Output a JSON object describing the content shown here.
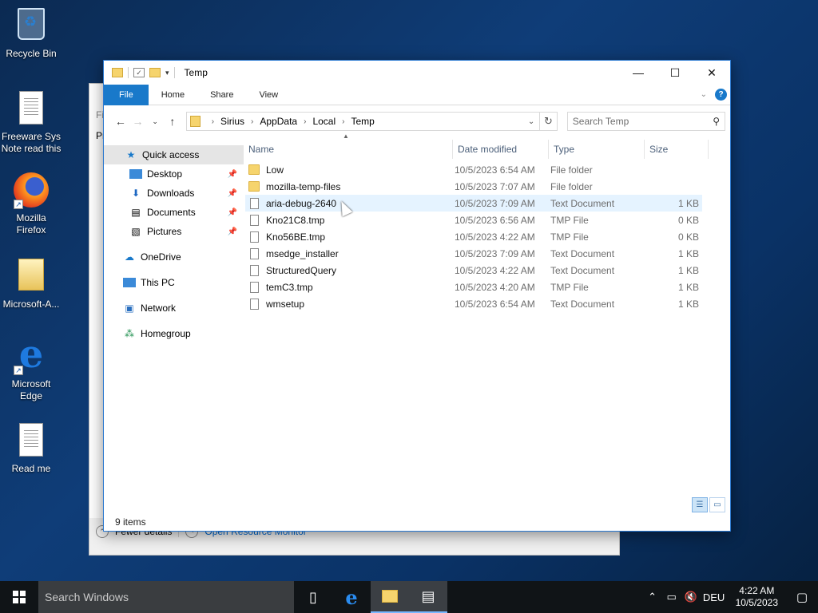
{
  "desktop": {
    "icons": [
      {
        "label": "Recycle Bin",
        "icon": "recycle-bin-icon"
      },
      {
        "label": "Freeware Sys Note read this",
        "icon": "text-document-icon"
      },
      {
        "label": "Mozilla Firefox",
        "icon": "firefox-icon"
      },
      {
        "label": "Microsoft-A...",
        "icon": "folder-icon"
      },
      {
        "label": "Microsoft Edge",
        "icon": "edge-icon"
      },
      {
        "label": "Read me",
        "icon": "text-document-icon"
      }
    ]
  },
  "background_window": {
    "menu_fragment": "Fi",
    "tab_fragment": "Pr",
    "fewer_details": "Fewer details",
    "open_resource_monitor": "Open Resource Monitor"
  },
  "explorer": {
    "title": "Temp",
    "ribbon_tabs": [
      "File",
      "Home",
      "Share",
      "View"
    ],
    "breadcrumb": [
      "Sirius",
      "AppData",
      "Local",
      "Temp"
    ],
    "search_placeholder": "Search Temp",
    "nav": {
      "quick_access": "Quick access",
      "pinned": [
        "Desktop",
        "Downloads",
        "Documents",
        "Pictures"
      ],
      "onedrive": "OneDrive",
      "this_pc": "This PC",
      "network": "Network",
      "homegroup": "Homegroup"
    },
    "columns": {
      "name": "Name",
      "date": "Date modified",
      "type": "Type",
      "size": "Size"
    },
    "files": [
      {
        "name": "Low",
        "date": "10/5/2023 6:54 AM",
        "type": "File folder",
        "size": "",
        "kind": "folder"
      },
      {
        "name": "mozilla-temp-files",
        "date": "10/5/2023 7:07 AM",
        "type": "File folder",
        "size": "",
        "kind": "folder"
      },
      {
        "name": "aria-debug-2640",
        "date": "10/5/2023 7:09 AM",
        "type": "Text Document",
        "size": "1 KB",
        "kind": "file"
      },
      {
        "name": "Kno21C8.tmp",
        "date": "10/5/2023 6:56 AM",
        "type": "TMP File",
        "size": "0 KB",
        "kind": "file"
      },
      {
        "name": "Kno56BE.tmp",
        "date": "10/5/2023 4:22 AM",
        "type": "TMP File",
        "size": "0 KB",
        "kind": "file"
      },
      {
        "name": "msedge_installer",
        "date": "10/5/2023 7:09 AM",
        "type": "Text Document",
        "size": "1 KB",
        "kind": "file"
      },
      {
        "name": "StructuredQuery",
        "date": "10/5/2023 4:22 AM",
        "type": "Text Document",
        "size": "1 KB",
        "kind": "file"
      },
      {
        "name": "temC3.tmp",
        "date": "10/5/2023 4:20 AM",
        "type": "TMP File",
        "size": "1 KB",
        "kind": "file"
      },
      {
        "name": "wmsetup",
        "date": "10/5/2023 6:54 AM",
        "type": "Text Document",
        "size": "1 KB",
        "kind": "file"
      }
    ],
    "status": "9 items"
  },
  "taskbar": {
    "search_placeholder": "Search Windows",
    "language": "DEU",
    "time": "4:22 AM",
    "date": "10/5/2023"
  },
  "colors": {
    "accent": "#1979ca",
    "taskbar": "#101417"
  }
}
